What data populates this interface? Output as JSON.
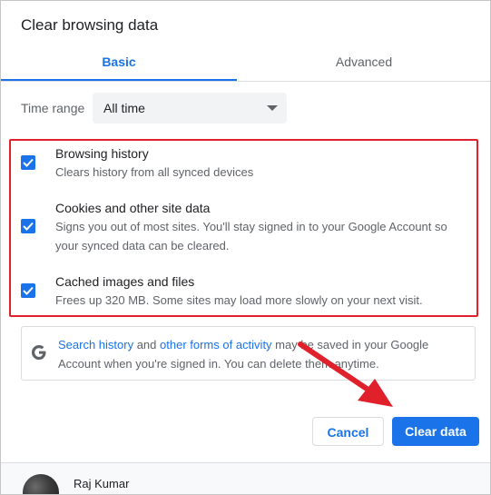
{
  "dialog": {
    "title": "Clear browsing data",
    "tabs": [
      {
        "label": "Basic",
        "active": true
      },
      {
        "label": "Advanced",
        "active": false
      }
    ]
  },
  "time_range": {
    "label": "Time range",
    "value": "All time"
  },
  "options": [
    {
      "title": "Browsing history",
      "desc": [
        "Clears history from all synced devices"
      ],
      "checked": true
    },
    {
      "title": "Cookies and other site data",
      "desc": [
        "Signs you out of most sites. You'll stay signed in to your Google Account so",
        "your synced data can be cleared."
      ],
      "checked": true
    },
    {
      "title": "Cached images and files",
      "desc": [
        "Frees up 320 MB. Some sites may load more slowly on your next visit."
      ],
      "checked": true
    }
  ],
  "info": {
    "icon": "google-g-icon",
    "link1": "Search history",
    "and": " and ",
    "link2": "other forms of activity",
    "rest1": " may be saved in your Google",
    "line2": "Account when you're signed in. You can delete them anytime."
  },
  "buttons": {
    "cancel": "Cancel",
    "clear": "Clear data"
  },
  "account": {
    "name": "Raj Kumar"
  },
  "colors": {
    "accent": "#1a73e8",
    "highlight": "#e0202a"
  }
}
